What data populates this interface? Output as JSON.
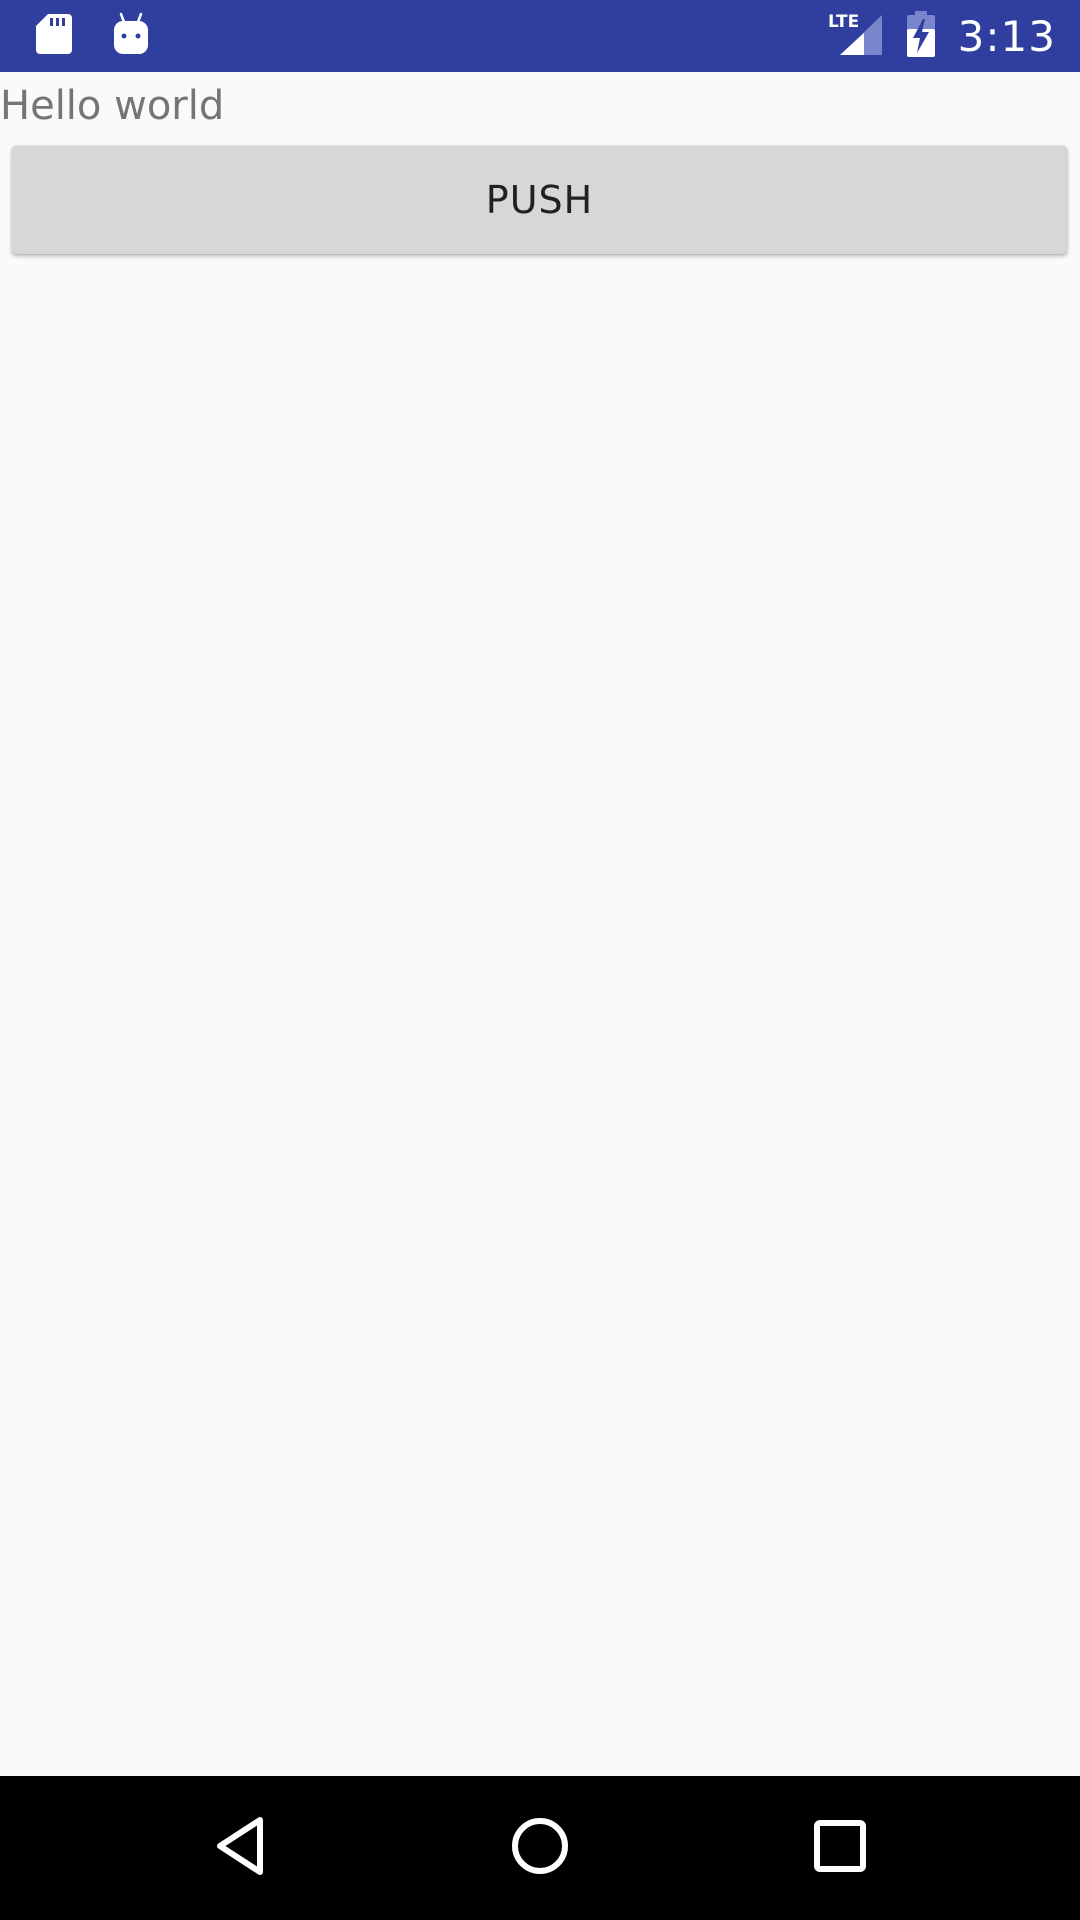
{
  "status_bar": {
    "time": "3:13",
    "network_label": "LTE",
    "left_icons": [
      "sd-card-icon",
      "android-robot-icon"
    ],
    "right_icons": [
      "lte-signal-icon",
      "battery-charging-icon"
    ],
    "background_color": "#303f9f"
  },
  "main": {
    "hello_text": "Hello world",
    "push_button_label": "PUSH",
    "background_color": "#fafafa",
    "button_color": "#d6d7d7"
  },
  "nav_bar": {
    "icons": [
      "back-icon",
      "home-icon",
      "recents-icon"
    ],
    "background_color": "#000000"
  }
}
